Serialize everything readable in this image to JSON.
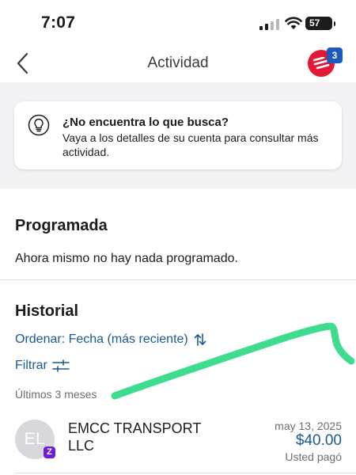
{
  "status_bar": {
    "time": "7:07",
    "battery": "57"
  },
  "nav": {
    "title": "Actividad",
    "notification_count": "3"
  },
  "info": {
    "title": "¿No encuentra lo que busca?",
    "body": "Vaya a los detalles de su cuenta para consultar más actividad."
  },
  "scheduled": {
    "title": "Programada",
    "empty_text": "Ahora mismo no hay nada programado."
  },
  "history": {
    "title": "Historial",
    "sort_label": "Ordenar: Fecha (más reciente)",
    "filter_label": "Filtrar",
    "period_label": "Últimos 3 meses",
    "transactions": [
      {
        "initials": "EL",
        "badge": "Z",
        "merchant": "EMCC TRANSPORT LLC",
        "date": "may 13, 2025",
        "amount": "$40.00",
        "status": "Usted pagó"
      }
    ]
  },
  "colors": {
    "brand_red": "#e31837",
    "link_blue": "#1a5a96",
    "badge_blue": "#1a5bbf",
    "zelle_purple": "#6d1ed4",
    "annotation_green": "#3ddc8f"
  }
}
